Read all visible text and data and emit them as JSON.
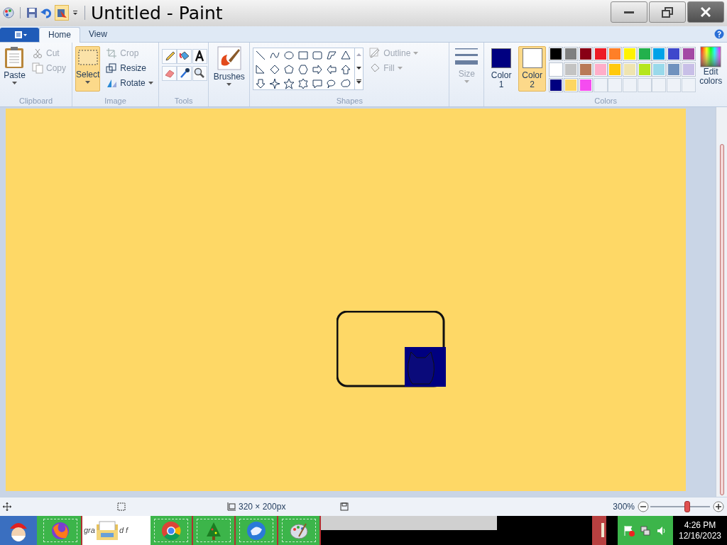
{
  "window": {
    "title": "Untitled - Paint"
  },
  "tabs": [
    {
      "label": "Home",
      "selected": true
    },
    {
      "label": "View",
      "selected": false
    }
  ],
  "clipboard": {
    "paste": "Paste",
    "cut": "Cut",
    "copy": "Copy",
    "group": "Clipboard"
  },
  "image": {
    "select": "Select",
    "crop": "Crop",
    "resize": "Resize",
    "rotate": "Rotate",
    "group": "Image"
  },
  "tools": {
    "group": "Tools"
  },
  "brushes": {
    "label": "Brushes"
  },
  "shapes": {
    "outline": "Outline",
    "fill": "Fill",
    "group": "Shapes"
  },
  "size": {
    "label": "Size"
  },
  "colors": {
    "group": "Colors",
    "edit": [
      "Edit",
      "colors"
    ],
    "slots": [
      {
        "label": [
          "Color",
          "1"
        ],
        "color": "#000080",
        "selected": false
      },
      {
        "label": [
          "Color",
          "2"
        ],
        "color": "#ffffff",
        "selected": true
      }
    ],
    "palette": [
      {
        "color": "#000000"
      },
      {
        "color": "#7f7f7f"
      },
      {
        "color": "#880015"
      },
      {
        "color": "#ed1c24"
      },
      {
        "color": "#ff7f27"
      },
      {
        "color": "#fff200"
      },
      {
        "color": "#22b14c"
      },
      {
        "color": "#00a2e8"
      },
      {
        "color": "#3f48cc"
      },
      {
        "color": "#a349a4"
      },
      {
        "color": "#ffffff"
      },
      {
        "color": "#c3c3c3"
      },
      {
        "color": "#b97a57"
      },
      {
        "color": "#ffaec9"
      },
      {
        "color": "#ffc90e"
      },
      {
        "color": "#efe4b0"
      },
      {
        "color": "#b5e61d"
      },
      {
        "color": "#99d9ea"
      },
      {
        "color": "#7092be"
      },
      {
        "color": "#c8bfe7"
      },
      {
        "color": "#000080"
      },
      {
        "color": "#fdd662"
      },
      {
        "color": "#f54cf0"
      }
    ]
  },
  "status_bar": {
    "size": "320 × 200px",
    "zoom": "300%",
    "zoom_slider": {
      "level": 0.62
    }
  },
  "taskbar": {
    "window_label": [
      "gra",
      "d f"
    ],
    "clock": {
      "time": "4:26 PM",
      "date": "12/16/2023"
    }
  }
}
